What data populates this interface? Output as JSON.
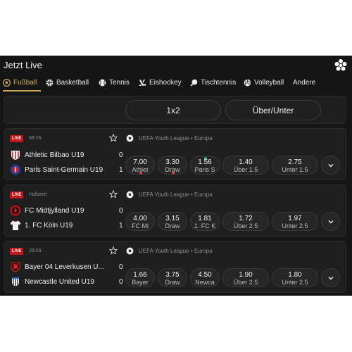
{
  "header": {
    "title": "Jetzt Live",
    "menu_icon": "ball-cluster-icon"
  },
  "tabs": [
    {
      "label": "Fußball",
      "icon": "soccer-ball-icon",
      "active": true
    },
    {
      "label": "Basketball",
      "icon": "basketball-icon"
    },
    {
      "label": "Tennis",
      "icon": "tennis-ball-icon"
    },
    {
      "label": "Eishockey",
      "icon": "hockey-stick-icon"
    },
    {
      "label": "Tischtennis",
      "icon": "ping-pong-paddle-icon"
    },
    {
      "label": "Volleyball",
      "icon": "volleyball-icon"
    },
    {
      "label": "Andere"
    }
  ],
  "filters": {
    "market1": "1x2",
    "market2": "Über/Unter"
  },
  "matches": [
    {
      "live": "LIVE",
      "time": "68:26",
      "league": "UEFA Youth League • Europa",
      "home": {
        "name": "Athletic Bilbao U19",
        "score": "0"
      },
      "away": {
        "name": "Paris Saint-Germain U19",
        "score": "1"
      },
      "odds": [
        {
          "value": "7.00",
          "label": "Athlet"
        },
        {
          "value": "3.30",
          "label": "Draw"
        },
        {
          "value": "1.56",
          "label": "Paris S"
        },
        {
          "value": "1.40",
          "label": "Über 1.5"
        },
        {
          "value": "2.75",
          "label": "Unter 1.5"
        }
      ]
    },
    {
      "live": "LIVE",
      "time": "Halbzeit",
      "league": "UEFA Youth League • Europa",
      "home": {
        "name": "FC Midtjylland U19",
        "score": "0"
      },
      "away": {
        "name": "1. FC Köln U19",
        "score": "1"
      },
      "odds": [
        {
          "value": "4.00",
          "label": "FC Mi"
        },
        {
          "value": "3.15",
          "label": "Draw"
        },
        {
          "value": "1.81",
          "label": "1. FC K"
        },
        {
          "value": "1.72",
          "label": "Über 2.5"
        },
        {
          "value": "1.97",
          "label": "Unter 2.5"
        }
      ]
    },
    {
      "live": "LIVE",
      "time": "28:03",
      "league": "UEFA Youth League • Europa",
      "home": {
        "name": "Bayer 04 Leverkusen U...",
        "score": "0"
      },
      "away": {
        "name": "Newcastle United U19",
        "score": "0"
      },
      "odds": [
        {
          "value": "1.66",
          "label": "Bayer"
        },
        {
          "value": "3.75",
          "label": "Draw"
        },
        {
          "value": "4.50",
          "label": "Newca"
        },
        {
          "value": "1.90",
          "label": "Über 2.5"
        },
        {
          "value": "1.80",
          "label": "Unter 2.5"
        }
      ]
    }
  ],
  "colors": {
    "accent": "#c9a45c",
    "live": "#c4161c",
    "up": "#3dbb5a",
    "down": "#e04646"
  }
}
